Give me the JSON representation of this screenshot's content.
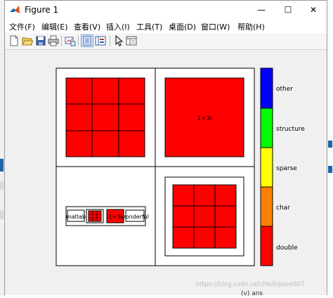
{
  "window": {
    "title": "Figure 1"
  },
  "window_controls": {
    "minimize": "—",
    "maximize": "☐",
    "close": "✕"
  },
  "menu": {
    "items": [
      {
        "label": "文件(F)"
      },
      {
        "label": "编辑(E)"
      },
      {
        "label": "查看(V)"
      },
      {
        "label": "插入(I)"
      },
      {
        "label": "工具(T)"
      },
      {
        "label": "桌面(D)"
      },
      {
        "label": "窗口(W)"
      },
      {
        "label": "帮助(H)"
      }
    ]
  },
  "toolbar": {
    "icons": [
      "new-figure-icon",
      "open-file-icon",
      "save-icon",
      "print-icon",
      "link-plot-icon",
      "hide-plot-tools-icon",
      "show-plot-tools-icon",
      "edit-plot-pointer-icon",
      "open-property-inspector-icon"
    ]
  },
  "figure": {
    "colors": {
      "red": "#ff0000",
      "white": "#ffffff",
      "black": "#000000"
    },
    "cell_labels": {
      "complex": "1+3i",
      "complex_small": "1+3i"
    },
    "nested_labels": {
      "left": "matlab",
      "right": "wonderful"
    },
    "legend": {
      "items": [
        {
          "label": "other",
          "color": "#0000ff"
        },
        {
          "label": "structure",
          "color": "#00ff00"
        },
        {
          "label": "sparse",
          "color": "#ffff00"
        },
        {
          "label": "char",
          "color": "#ff8000"
        },
        {
          "label": "double",
          "color": "#ff0000"
        }
      ]
    }
  },
  "footer": {
    "watermark": "https://blog.csdn.net/HelloJane007",
    "ans": "(v) ans"
  }
}
